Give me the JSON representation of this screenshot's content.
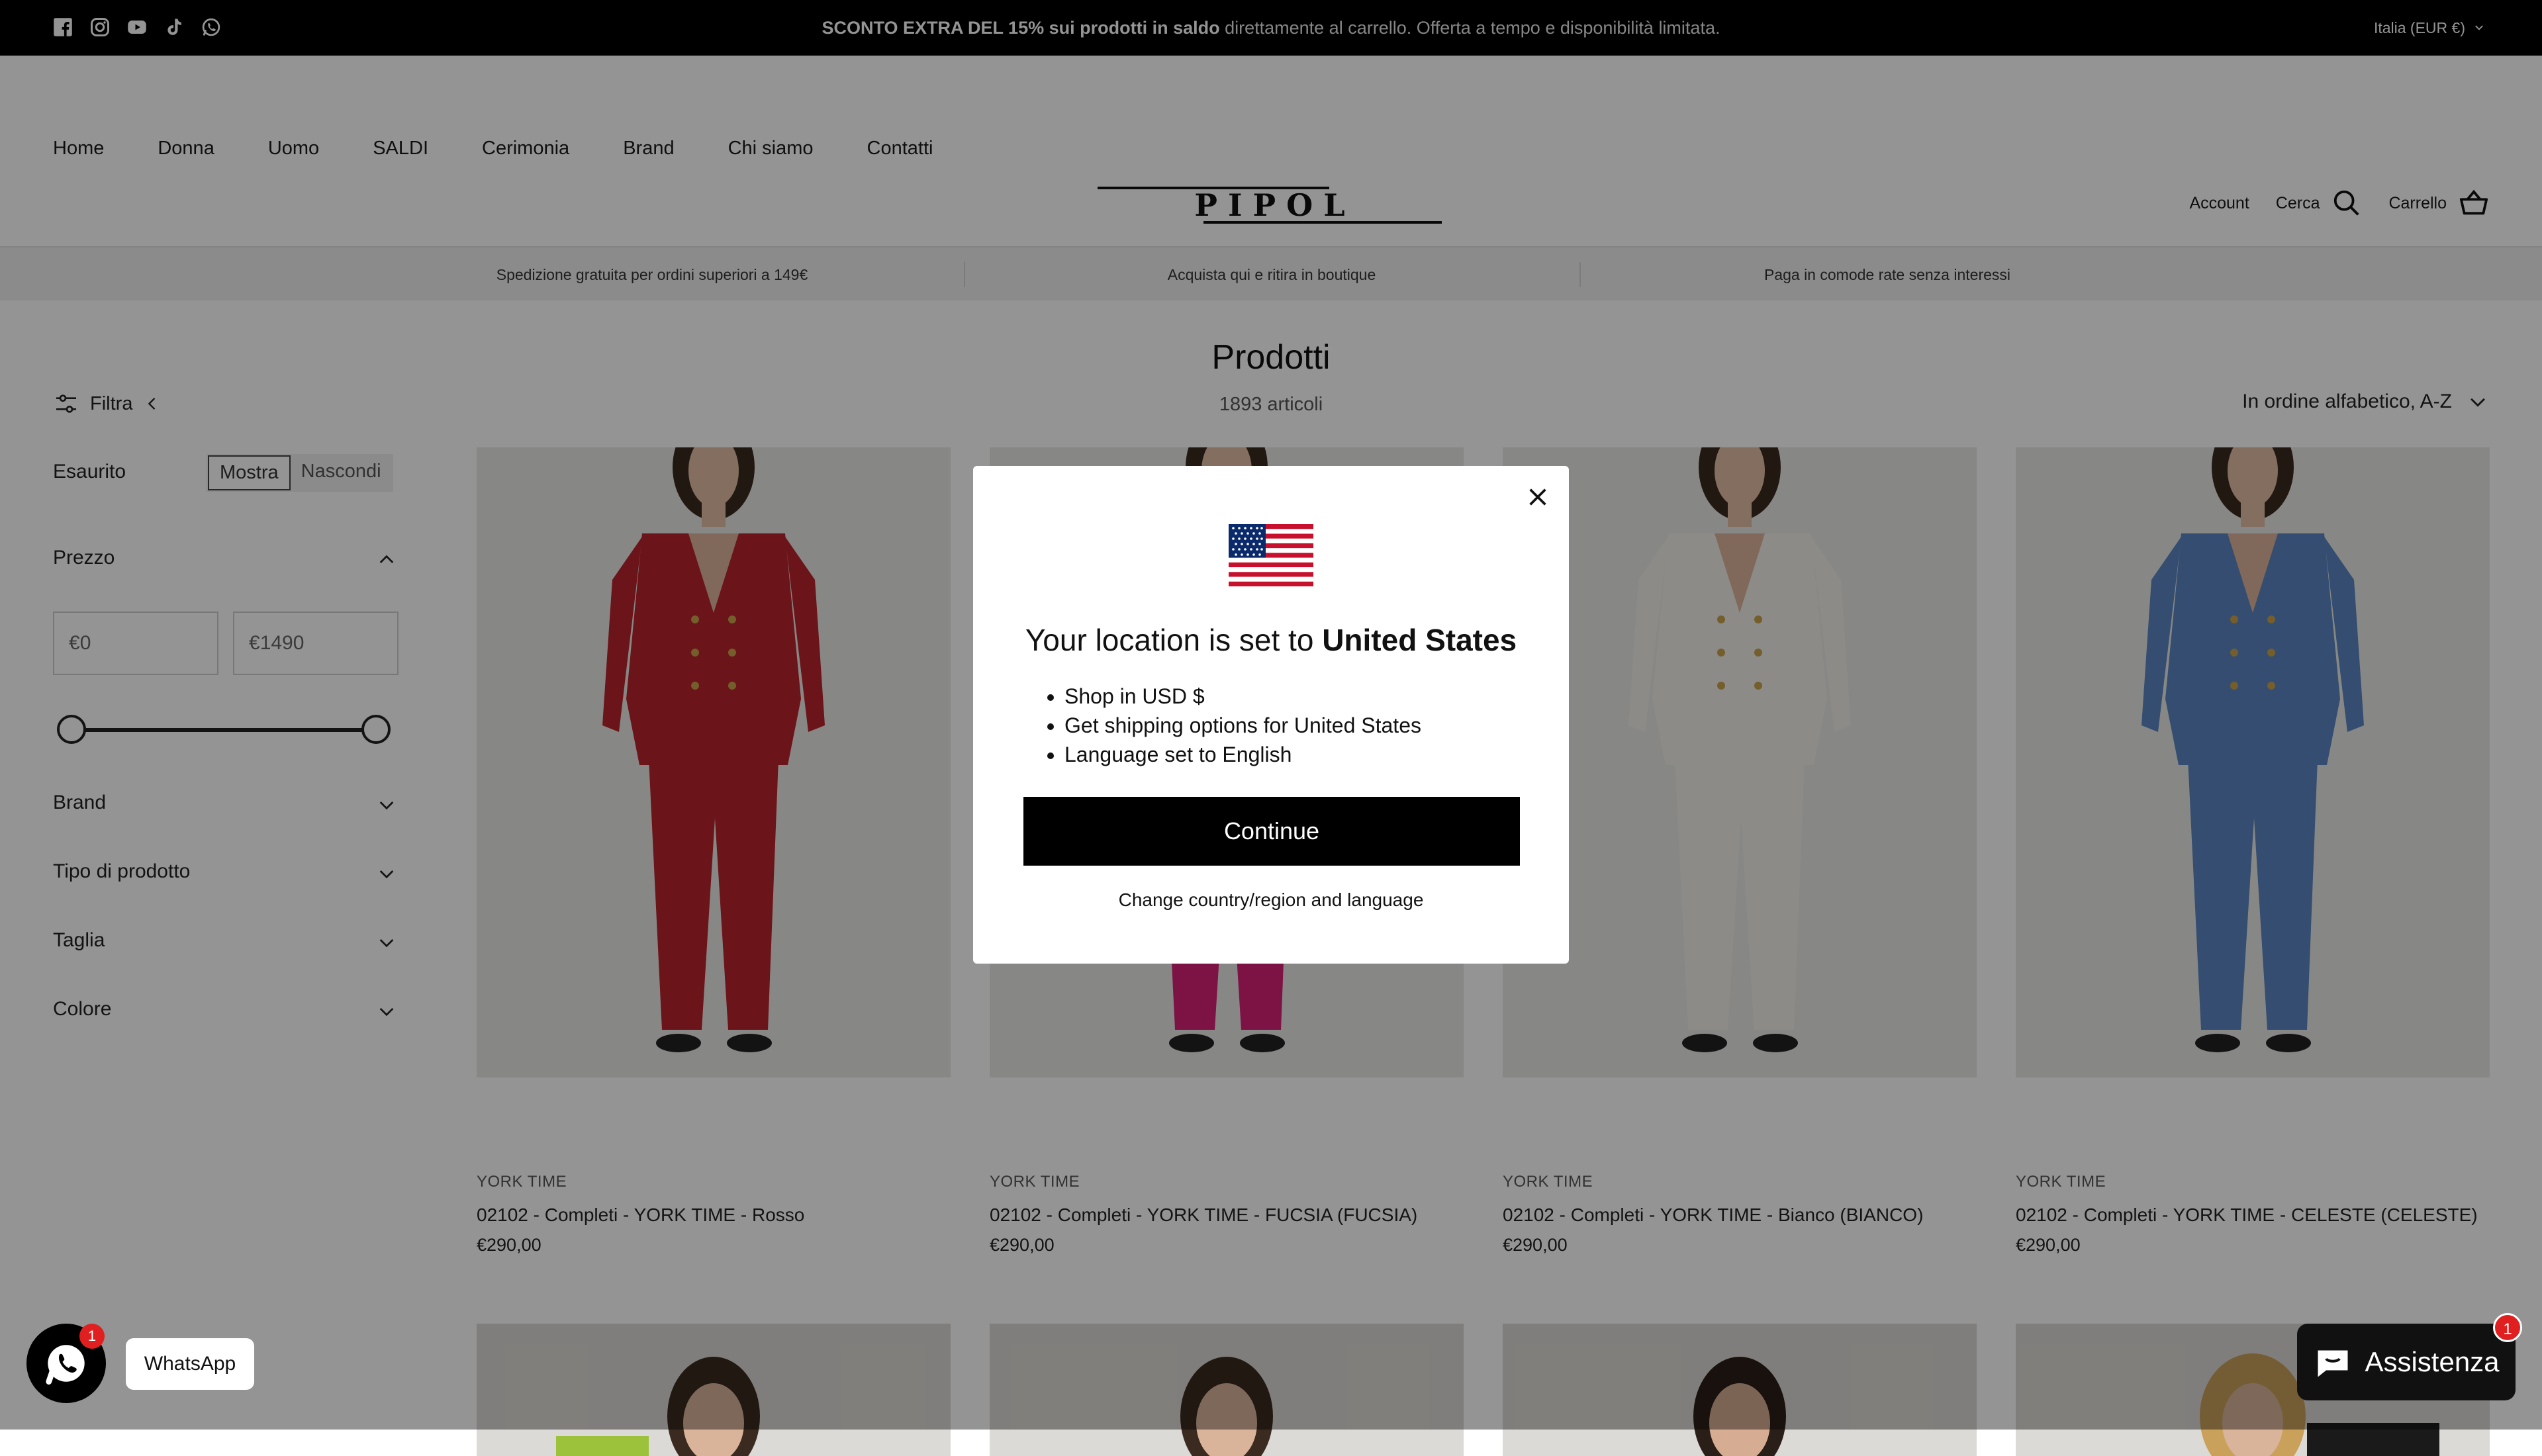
{
  "announcement": {
    "promo_bold": "SCONTO EXTRA DEL 15% sui prodotti in saldo",
    "promo_rest": " direttamente al carrello. Offerta a tempo e disponibilità limitata.",
    "locale": "Italia (EUR €)",
    "social_icons": [
      "facebook-icon",
      "instagram-icon",
      "youtube-icon",
      "tiktok-icon",
      "whatsapp-icon"
    ]
  },
  "nav": {
    "items": [
      "Home",
      "Donna",
      "Uomo",
      "SALDI",
      "Cerimonia",
      "Brand",
      "Chi siamo",
      "Contatti"
    ]
  },
  "logo": {
    "text": "P I P O L"
  },
  "header_actions": {
    "account": "Account",
    "search": "Cerca",
    "cart": "Carrello"
  },
  "usp": [
    "Spedizione gratuita per ordini superiori a 149€",
    "Acquista qui e ritira in boutique",
    "Paga in comode rate senza interessi"
  ],
  "page": {
    "title": "Prodotti",
    "count": "1893 articoli",
    "sort": "In ordine alfabetico, A-Z"
  },
  "filters": {
    "toggle": "Filtra",
    "esaurito": {
      "label": "Esaurito",
      "show": "Mostra",
      "hide": "Nascondi",
      "selected": "Mostra"
    },
    "price": {
      "label": "Prezzo",
      "min": "0",
      "max": "1490",
      "currency": "€"
    },
    "facets": [
      "Brand",
      "Tipo di prodotto",
      "Taglia",
      "Colore"
    ]
  },
  "products": [
    {
      "brand": "YORK TIME",
      "title": "02102 - Completi - YORK TIME - Rosso",
      "price": "€290,00",
      "color": "#b8232b"
    },
    {
      "brand": "YORK TIME",
      "title": "02102 - Completi - YORK TIME - FUCSIA (FUCSIA)",
      "price": "€290,00",
      "color": "#d81f78"
    },
    {
      "brand": "YORK TIME",
      "title": "02102 - Completi - YORK TIME - Bianco (BIANCO)",
      "price": "€290,00",
      "color": "#f2f0ea"
    },
    {
      "brand": "YORK TIME",
      "title": "02102 - Completi - YORK TIME - CELESTE (CELESTE)",
      "price": "€290,00",
      "color": "#5a86c2"
    }
  ],
  "modal": {
    "title_prefix": "Your location is set to ",
    "title_country": "United States",
    "bullets": [
      "Shop in USD $",
      "Get shipping options for United States",
      "Language set to English"
    ],
    "continue": "Continue",
    "change": "Change country/region and language"
  },
  "widgets": {
    "whatsapp_label": "WhatsApp",
    "whatsapp_badge": "1",
    "chat_label": "Assistenza",
    "chat_badge": "1"
  }
}
